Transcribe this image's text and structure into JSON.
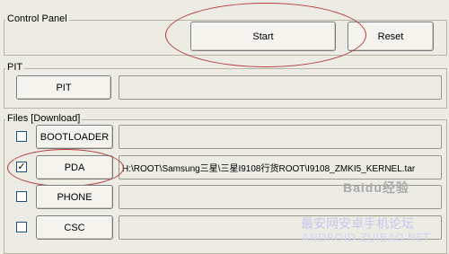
{
  "control_panel": {
    "legend": "Control Panel",
    "start_label": "Start",
    "reset_label": "Reset"
  },
  "pit": {
    "legend": "PIT",
    "button_label": "PIT",
    "path_value": ""
  },
  "files": {
    "legend": "Files [Download]",
    "rows": [
      {
        "label": "BOOTLOADER",
        "checked": false,
        "path": ""
      },
      {
        "label": "PDA",
        "checked": true,
        "path": "H:\\ROOT\\Samsung三星\\三星I9108行货ROOT\\I9108_ZMKI5_KERNEL.tar"
      },
      {
        "label": "PHONE",
        "checked": false,
        "path": ""
      },
      {
        "label": "CSC",
        "checked": false,
        "path": ""
      }
    ]
  },
  "watermark": {
    "brand": "Baidu经验",
    "site_cn": "最安网安卓手机论坛",
    "site_en": "ANDROID.ZUIBAO.NET"
  },
  "colors": {
    "highlight_ring": "#b73a3a",
    "checkbox_border": "#1c5180"
  }
}
